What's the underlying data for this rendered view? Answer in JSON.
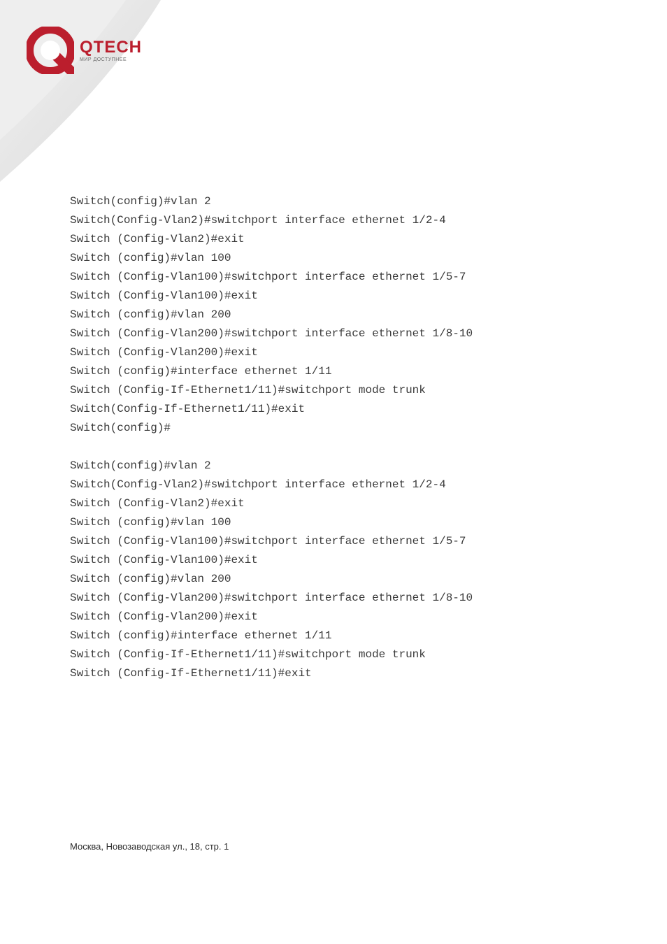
{
  "brand": {
    "name": "QTECH",
    "tagline": "МИР ДОСТУПНЕЕ",
    "accent": "#bb1e2d"
  },
  "blocks": {
    "b1": [
      "Switch(config)#vlan 2",
      "Switch(Config-Vlan2)#switchport interface ethernet 1/2-4",
      "Switch (Config-Vlan2)#exit",
      "Switch (config)#vlan 100",
      "Switch (Config-Vlan100)#switchport interface ethernet 1/5-7",
      "Switch (Config-Vlan100)#exit",
      "Switch (config)#vlan 200",
      "Switch (Config-Vlan200)#switchport interface ethernet 1/8-10",
      "Switch (Config-Vlan200)#exit",
      "Switch (config)#interface ethernet 1/11",
      "Switch (Config-If-Ethernet1/11)#switchport mode trunk",
      "Switch(Config-If-Ethernet1/11)#exit",
      "Switch(config)#"
    ],
    "b2": [
      "Switch(config)#vlan 2",
      "Switch(Config-Vlan2)#switchport interface ethernet 1/2-4",
      "Switch (Config-Vlan2)#exit",
      "Switch (config)#vlan 100",
      "Switch (Config-Vlan100)#switchport interface ethernet 1/5-7",
      "Switch (Config-Vlan100)#exit",
      "Switch (config)#vlan 200",
      "Switch (Config-Vlan200)#switchport interface ethernet 1/8-10",
      "Switch (Config-Vlan200)#exit",
      "Switch (config)#interface ethernet 1/11",
      "Switch (Config-If-Ethernet1/11)#switchport mode trunk",
      "Switch (Config-If-Ethernet1/11)#exit"
    ]
  },
  "footer": {
    "address": "Москва, Новозаводская ул., 18, стр. 1"
  }
}
